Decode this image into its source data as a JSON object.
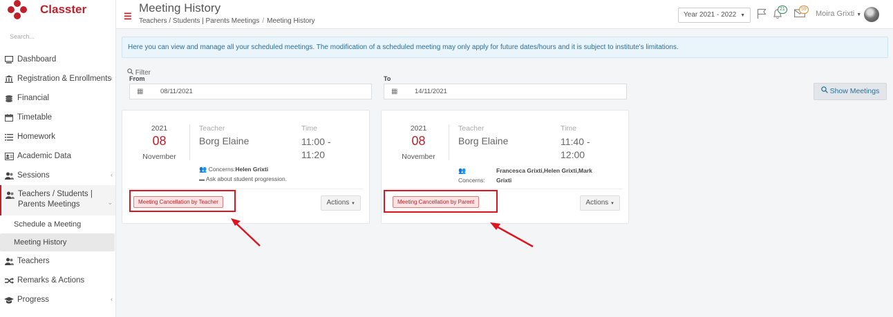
{
  "brand": {
    "name": "Classter",
    "color": "#c0202a"
  },
  "sidebar": {
    "search_placeholder": "Search...",
    "items": [
      {
        "label": "Dashboard",
        "icon": "monitor-icon"
      },
      {
        "label": "Registration & Enrollments",
        "icon": "institution-icon"
      },
      {
        "label": "Financial",
        "icon": "money-icon"
      },
      {
        "label": "Timetable",
        "icon": "calendar-icon"
      },
      {
        "label": "Homework",
        "icon": "list-icon"
      },
      {
        "label": "Academic Data",
        "icon": "id-card-icon"
      },
      {
        "label": "Sessions",
        "icon": "users-icon"
      },
      {
        "label": "Teachers / Students | Parents Meetings",
        "icon": "users-icon"
      },
      {
        "label": "Teachers",
        "icon": "users-icon"
      },
      {
        "label": "Remarks & Actions",
        "icon": "shuffle-icon"
      },
      {
        "label": "Progress",
        "icon": "graduation-cap-icon"
      }
    ],
    "sub_items": [
      {
        "label": "Schedule a Meeting"
      },
      {
        "label": "Meeting History"
      }
    ]
  },
  "header": {
    "title": "Meeting History",
    "breadcrumb": [
      "Teachers / Students | Parents Meetings",
      "Meeting History"
    ],
    "year_select": "Year 2021 - 2022",
    "notifications_count": "21",
    "messages_count": "59",
    "user_name": "Moira Grixti"
  },
  "info": {
    "text": "Here you can view and manage all your scheduled meetings. The modification of a scheduled meeting may only apply for future dates/hours and it is subject to institute's limitations."
  },
  "filter": {
    "title": "Filter",
    "from_label": "From",
    "from_value": "08/11/2021",
    "to_label": "To",
    "to_value": "14/11/2021",
    "show_button": "Show Meetings"
  },
  "meetings": [
    {
      "year": "2021",
      "day": "08",
      "month": "November",
      "teacher_label": "Teacher",
      "teacher": "Borg Elaine",
      "time_label": "Time",
      "time": "11:00 - 11:20",
      "concerns_label": "Concerns:",
      "concerns": "Helen Grixti",
      "note": "Ask about student progression.",
      "status": "Meeting Cancellation by Teacher",
      "actions_label": "Actions"
    },
    {
      "year": "2021",
      "day": "08",
      "month": "November",
      "teacher_label": "Teacher",
      "teacher": "Borg Elaine",
      "time_label": "Time",
      "time": "11:40 - 12:00",
      "concerns_label": "Concerns:",
      "concerns": "Francesca Grixti,Helen Grixti,Mark Grixti",
      "status": "Meeting Cancellation by Parent",
      "actions_label": "Actions"
    }
  ],
  "colors": {
    "accent": "#c0202a",
    "highlight": "#e0141e",
    "info_bg": "#eaf4fb",
    "link": "#2a6f99"
  }
}
